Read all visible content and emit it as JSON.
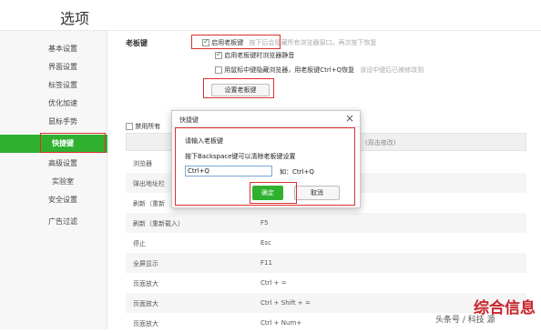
{
  "window": {
    "title": "选项"
  },
  "sidebar": {
    "items": [
      {
        "label": "基本设置",
        "active": false
      },
      {
        "label": "界面设置",
        "active": false
      },
      {
        "label": "标签设置",
        "active": false
      },
      {
        "label": "优化加速",
        "active": false
      },
      {
        "label": "鼠标手势",
        "active": false
      },
      {
        "label": "快捷键",
        "active": true
      },
      {
        "label": "高级设置",
        "active": false
      },
      {
        "label": "实验室",
        "active": false
      },
      {
        "label": "安全设置",
        "active": false
      },
      {
        "label": "广告过滤",
        "active": false
      }
    ]
  },
  "boss_key": {
    "section_title": "老板键",
    "enable_label": "启用老板键",
    "enable_hint": "按下后会隐藏所有浏览器窗口，再次按下恢复",
    "sub1_label": "启用老板键时浏览器静音",
    "sub2_label": "用鼠标中键隐藏浏览器，用老板键Ctrl+Q恢复",
    "sub2_hint": "该设中键后已被修改到",
    "set_button": "设置老板键"
  },
  "shortcuts": {
    "disable_all_label": "禁用所有",
    "header_hint": "(双击修改)",
    "rows": [
      {
        "name": "浏览器",
        "key": ""
      },
      {
        "name": "弹出地址栏",
        "key": ""
      },
      {
        "name": "刷新（重新",
        "key": ""
      },
      {
        "name": "刷新（重新载入）",
        "key": "F5"
      },
      {
        "name": "停止",
        "key": "Esc"
      },
      {
        "name": "全屏显示",
        "key": "F11"
      },
      {
        "name": "页面放大",
        "key": "Ctrl + ="
      },
      {
        "name": "页面放大",
        "key": "Ctrl + Shift + ="
      },
      {
        "name": "页面放大",
        "key": "Ctrl + Num+"
      }
    ]
  },
  "dialog": {
    "title": "快捷键",
    "close_glyph": "×",
    "prompt": "请输入老板键",
    "instruction": "按下Backspace键可以清除老板键设置",
    "input_value": "Ctrl+Q",
    "example": "如：Ctrl+Q",
    "ok_button": "确定",
    "cancel_button": "取消"
  },
  "watermark": {
    "brand": "综合信息",
    "source": "头条号 / 科技 源"
  },
  "colors": {
    "accent_green": "#2fb12f",
    "highlight_red": "#d9312f"
  }
}
